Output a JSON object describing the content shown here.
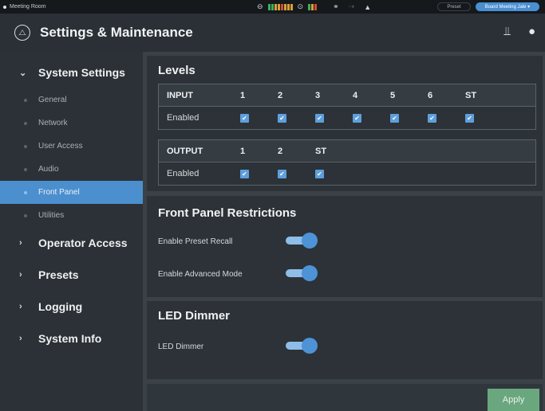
{
  "topbar": {
    "room_name": "Meeting Room",
    "preset_label": "Preset",
    "preset_value": "Board Meeting Jale ▾"
  },
  "header": {
    "title": "Settings & Maintenance"
  },
  "sidebar": {
    "system_settings": "System Settings",
    "items": [
      {
        "label": "General"
      },
      {
        "label": "Network"
      },
      {
        "label": "User Access"
      },
      {
        "label": "Audio"
      },
      {
        "label": "Front Panel"
      },
      {
        "label": "Utilities"
      }
    ],
    "operator_access": "Operator Access",
    "presets": "Presets",
    "logging": "Logging",
    "system_info": "System Info"
  },
  "levels": {
    "title": "Levels",
    "input_header": "INPUT",
    "input_columns": [
      "1",
      "2",
      "3",
      "4",
      "5",
      "6",
      "ST"
    ],
    "input_row_label": "Enabled",
    "output_header": "OUTPUT",
    "output_columns": [
      "1",
      "2",
      "ST"
    ],
    "output_row_label": "Enabled",
    "checkmark": "✔"
  },
  "front_panel": {
    "title": "Front Panel Restrictions",
    "preset_recall_label": "Enable Preset Recall",
    "advanced_mode_label": "Enable Advanced Mode"
  },
  "led": {
    "title": "LED Dimmer",
    "dimmer_label": "LED Dimmer"
  },
  "footer": {
    "apply_label": "Apply"
  },
  "colors": {
    "accent": "#4c8fcf",
    "apply": "#6aa77f"
  }
}
